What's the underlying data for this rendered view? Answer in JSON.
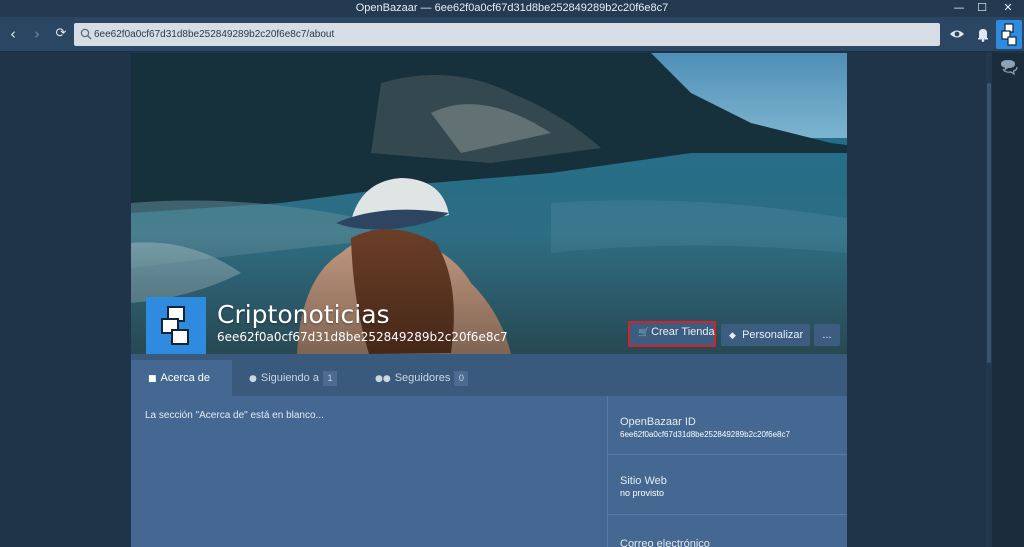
{
  "window": {
    "title": "OpenBazaar — 6ee62f0a0cf67d31d8be252849289b2c20f6e8c7",
    "minimize": "—",
    "maximize": "☐",
    "close": "✕"
  },
  "nav": {
    "back": "‹",
    "forward": "›",
    "refresh": "⟳",
    "url": "6ee62f0a0cf67d31d8be252849289b2c20f6e8c7/about",
    "icons": [
      "eye-icon",
      "bell-icon",
      "avatar-icon"
    ]
  },
  "colors": {
    "accent": "#2f8be0",
    "highlight_border": "#d2232a",
    "panel": "#446891"
  },
  "profile": {
    "name": "Criptonoticias",
    "id": "6ee62f0a0cf67d31d8be252849289b2c20f6e8c7"
  },
  "actions": {
    "crear_tienda": "Crear Tienda",
    "personalizar": "Personalizar",
    "more": "..."
  },
  "tabs": [
    {
      "label": "Acerca de",
      "icon": "chat-icon"
    },
    {
      "label": "Siguiendo a",
      "icon": "person-icon",
      "count": "1"
    },
    {
      "label": "Seguidores",
      "icon": "people-icon",
      "count": "0"
    }
  ],
  "about": {
    "blank_message": "La sección \"Acerca de\" está en blanco..."
  },
  "info": {
    "openbazaar_id_title": "OpenBazaar ID",
    "openbazaar_id_value": "6ee62f0a0cf67d31d8be252849289b2c20f6e8c7",
    "website_title": "Sitio Web",
    "website_value": "no provisto",
    "email_title": "Correo electrónico"
  }
}
